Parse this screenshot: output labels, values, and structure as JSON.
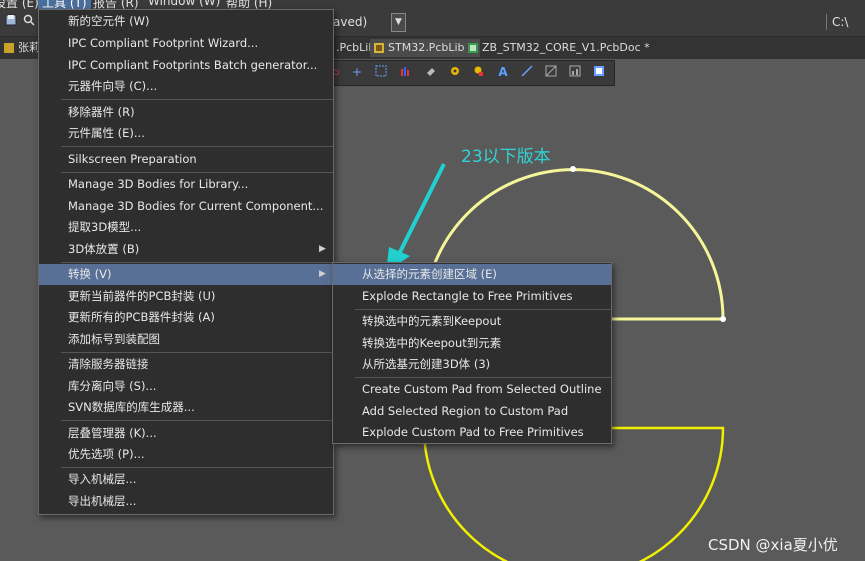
{
  "menubar": {
    "items": [
      "设置 (E)",
      "工具 (T)",
      "报告 (R)",
      "Window (W)",
      "帮助 (H)"
    ]
  },
  "toolbar": {
    "doc_title": "aved)",
    "right_text": "C:\\"
  },
  "tabs": [
    {
      "label": "张莉莉",
      "active": false
    },
    {
      "label": ".PcbLib",
      "active": false
    },
    {
      "label": "STM32.PcbLib *",
      "active": true
    },
    {
      "label": "ZB_STM32_CORE_V1.PcbDoc *",
      "active": false
    }
  ],
  "tools_menu": {
    "items": [
      {
        "label": "新的空元件 (W)"
      },
      {
        "label": "IPC Compliant Footprint Wizard..."
      },
      {
        "label": "IPC Compliant Footprints Batch generator..."
      },
      {
        "label": "元器件向导 (C)..."
      },
      {
        "label": "移除器件 (R)"
      },
      {
        "label": "元件属性 (E)..."
      },
      {
        "label": "Silkscreen Preparation"
      },
      {
        "label": "Manage 3D Bodies for Library..."
      },
      {
        "label": "Manage 3D Bodies for Current Component..."
      },
      {
        "label": "提取3D模型..."
      },
      {
        "label": "3D体放置 (B)"
      },
      {
        "label": "转换 (V)"
      },
      {
        "label": "更新当前器件的PCB封装 (U)"
      },
      {
        "label": "更新所有的PCB器件封装 (A)"
      },
      {
        "label": "添加标号到装配图"
      },
      {
        "label": "清除服务器链接"
      },
      {
        "label": "库分离向导 (S)..."
      },
      {
        "label": "SVN数据库的库生成器..."
      },
      {
        "label": "层叠管理器 (K)..."
      },
      {
        "label": "优先选项 (P)..."
      },
      {
        "label": "导入机械层..."
      },
      {
        "label": "导出机械层..."
      }
    ]
  },
  "convert_submenu": {
    "items": [
      {
        "label": "从选择的元素创建区域 (E)"
      },
      {
        "label": "Explode Rectangle to Free Primitives"
      },
      {
        "label": "转换选中的元素到Keepout"
      },
      {
        "label": "转换选中的Keepout到元素"
      },
      {
        "label": "从所选基元创建3D体 (3)"
      },
      {
        "label": "Create Custom Pad from Selected Outline"
      },
      {
        "label": "Add Selected Region to Custom Pad"
      },
      {
        "label": "Explode Custom Pad to Free Primitives"
      }
    ]
  },
  "annotation": {
    "text": "23以下版本",
    "color": "#2fd4d4"
  },
  "watermark": {
    "text": "CSDN @xia夏小优"
  },
  "colors": {
    "canvas_bg": "#5a5a5a",
    "menu_bg": "#2e2e2e",
    "highlight": "#587096",
    "shape_light": "#f5f59a",
    "shape_yellow": "#f0f000"
  }
}
